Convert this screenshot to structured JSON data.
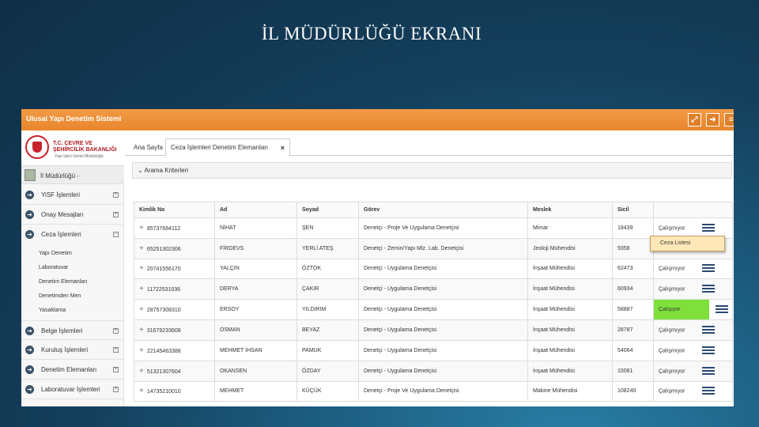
{
  "slide": {
    "title": "İL MÜDÜRLÜĞÜ EKRANI"
  },
  "app": {
    "system_name": "Ulusal Yapı Denetim Sistemi",
    "toolbar_icons": [
      "fullscreen-icon",
      "logout-icon",
      "collapse-icon"
    ],
    "accent_color": "#e8862d"
  },
  "sidebar": {
    "logo_line1": "T.C. ÇEVRE VE",
    "logo_line2": "ŞEHİRCİLİK BAKANLIĞI",
    "logo_line3": "Yapı İşleri Genel Müdürlüğü",
    "user_label": "İl Müdürlüğü -",
    "menu": [
      {
        "label": "YiSF İşlemleri",
        "toggle": "+"
      },
      {
        "label": "Onay Mesajları",
        "toggle": "+"
      },
      {
        "label": "Ceza İşlemleri",
        "toggle": "−"
      }
    ],
    "submenu": [
      "Yapı Denetim",
      "Laboratuvar",
      "Denetim Elemanları",
      "Denetimden Men",
      "Yasaklama"
    ],
    "menu_bottom": [
      {
        "label": "Belge İşlemleri",
        "toggle": "+"
      },
      {
        "label": "Kuruluş İşlemleri",
        "toggle": "+"
      },
      {
        "label": "Denetim Elemanları",
        "toggle": "+"
      },
      {
        "label": "Laboratuvar İşlemleri",
        "toggle": "+"
      }
    ]
  },
  "tabs": {
    "home": "Ana Sayfa",
    "active": "Ceza İşlemleri Denetim Elemanları",
    "close": "×"
  },
  "criteria_label": "⌄ Arama Kriterleri",
  "table": {
    "headers": [
      "Kimlik No",
      "Ad",
      "Soyad",
      "Görev",
      "Meslek",
      "Sicil",
      ""
    ],
    "rows": [
      {
        "kimlik": "85737684112",
        "ad": "NİHAT",
        "soyad": "ŞEN",
        "gorev": "Denetçi - Proje Ve Uygulama Denetçisi",
        "meslek": "Mimar",
        "sicil": "18439",
        "durum": "Çalışmıyor"
      },
      {
        "kimlik": "65251302306",
        "ad": "FİRDEVS",
        "soyad": "YERLİ ATEŞ",
        "gorev": "Denetçi - Zemin/Yapı Mlz. Lab. Denetçisi",
        "meslek": "Jeoloji Mühendisi",
        "sicil": "9358",
        "durum": ""
      },
      {
        "kimlik": "20741556170",
        "ad": "YALÇIN",
        "soyad": "ÖZTOK",
        "gorev": "Denetçi - Uygulama Denetçisi",
        "meslek": "İnşaat Mühendisi",
        "sicil": "62473",
        "durum": "Çalışmıyor"
      },
      {
        "kimlik": "11722531036",
        "ad": "DERYA",
        "soyad": "ÇAKIR",
        "gorev": "Denetçi - Uygulama Denetçisi",
        "meslek": "İnşaat Mühendisi",
        "sicil": "60934",
        "durum": "Çalışmıyor"
      },
      {
        "kimlik": "28757308310",
        "ad": "ERSOY",
        "soyad": "YILDIRIM",
        "gorev": "Denetçi - Uygulama Denetçisi",
        "meslek": "İnşaat Mühendisi",
        "sicil": "58887",
        "durum": "Çalışıyor"
      },
      {
        "kimlik": "31679233608",
        "ad": "OSMAN",
        "soyad": "BEYAZ",
        "gorev": "Denetçi - Uygulama Denetçisi",
        "meslek": "İnşaat Mühendisi",
        "sicil": "28787",
        "durum": "Çalışmıyor"
      },
      {
        "kimlik": "22145463388",
        "ad": "MEHMET İHSAN",
        "soyad": "PAMUK",
        "gorev": "Denetçi - Uygulama Denetçisi",
        "meslek": "İnşaat Mühendisi",
        "sicil": "54064",
        "durum": "Çalışmıyor"
      },
      {
        "kimlik": "51321307604",
        "ad": "OKANSEN",
        "soyad": "ÖZDAY",
        "gorev": "Denetçi - Uygulama Denetçisi",
        "meslek": "İnşaat Mühendisi",
        "sicil": "15061",
        "durum": "Çalışmıyor"
      },
      {
        "kimlik": "14735210010",
        "ad": "MEHMET",
        "soyad": "KÜÇÜK",
        "gorev": "Denetçi - Proje Ve Uygulama Denetçisi",
        "meslek": "Makine Mühendisi",
        "sicil": "108240",
        "durum": "Çalışmıyor"
      }
    ],
    "highlight_color": "#7fe03c"
  },
  "popup": {
    "label": "Ceza Listesi"
  }
}
